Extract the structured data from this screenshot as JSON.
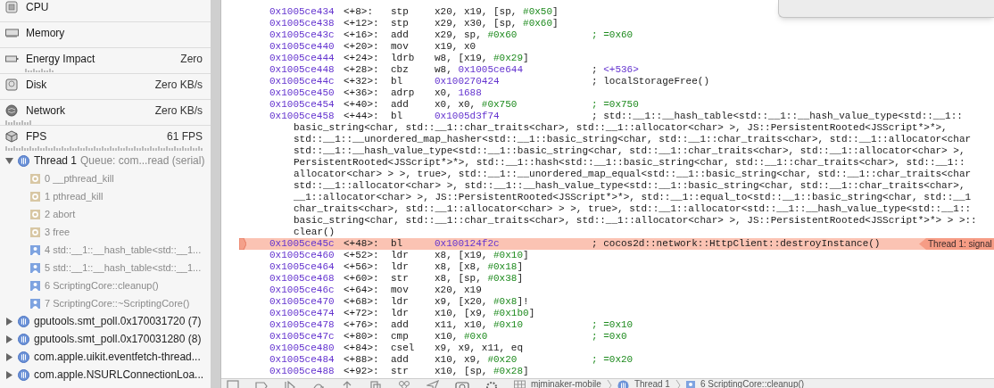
{
  "gauges": [
    {
      "kind": "cpu",
      "label": "CPU"
    },
    {
      "kind": "memory",
      "label": "Memory"
    },
    {
      "kind": "energy",
      "label": "Energy Impact",
      "value": "Zero"
    },
    {
      "kind": "disk",
      "label": "Disk",
      "value": "Zero KB/s"
    },
    {
      "kind": "network",
      "label": "Network",
      "value": "Zero KB/s"
    },
    {
      "kind": "fps",
      "label": "FPS",
      "value": "61 FPS"
    }
  ],
  "threads": [
    {
      "name": "Thread 1",
      "queue": "Queue: com...read (serial)",
      "expanded": true,
      "children": [
        {
          "kind": "system",
          "label": "0 __pthread_kill"
        },
        {
          "kind": "system",
          "label": "1 pthread_kill"
        },
        {
          "kind": "system",
          "label": "2 abort"
        },
        {
          "kind": "system",
          "label": "3 free"
        },
        {
          "kind": "user",
          "label": "4 std::__1::__hash_table<std::__1..."
        },
        {
          "kind": "user",
          "label": "5 std::__1::__hash_table<std::__1..."
        },
        {
          "kind": "user",
          "label": "6 ScriptingCore::cleanup()"
        },
        {
          "kind": "user",
          "label": "7 ScriptingCore::~ScriptingCore()"
        }
      ]
    },
    {
      "name": "gputools.smt_poll.0x170031720 (7)",
      "expanded": false
    },
    {
      "name": "gputools.smt_poll.0x170031280 (8)",
      "expanded": false
    },
    {
      "name": "com.apple.uikit.eventfetch-thread...",
      "expanded": false
    },
    {
      "name": "com.apple.NSURLConnectionLoa...",
      "expanded": false
    }
  ],
  "disassembly": [
    {
      "address": "0x1005ce434",
      "offset": "<+8>:",
      "mnemonic": "stp",
      "operands": "x20, x19, [sp, #0x50]",
      "current": false
    },
    {
      "address": "0x1005ce438",
      "offset": "<+12>:",
      "mnemonic": "stp",
      "operands": "x29, x30, [sp, #0x60]",
      "current": false
    },
    {
      "address": "0x1005ce43c",
      "offset": "<+16>:",
      "mnemonic": "add",
      "operands": "x29, sp, #0x60",
      "comment": "; =0x60",
      "current": false
    },
    {
      "address": "0x1005ce440",
      "offset": "<+20>:",
      "mnemonic": "mov",
      "operands": "x19, x0",
      "current": false
    },
    {
      "address": "0x1005ce444",
      "offset": "<+24>:",
      "mnemonic": "ldrb",
      "operands": "w8, [x19, #0x29]",
      "current": false
    },
    {
      "address": "0x1005ce448",
      "offset": "<+28>:",
      "mnemonic": "cbz",
      "operands": "w8, 0x1005ce644",
      "comment": "; <+536>",
      "current": false
    },
    {
      "address": "0x1005ce44c",
      "offset": "<+32>:",
      "mnemonic": "bl",
      "operands": "0x100270424",
      "comment": "; localStorageFree()",
      "current": false
    },
    {
      "address": "0x1005ce450",
      "offset": "<+36>:",
      "mnemonic": "adrp",
      "operands": "x0, 1688",
      "current": false
    },
    {
      "address": "0x1005ce454",
      "offset": "<+40>:",
      "mnemonic": "add",
      "operands": "x0, x0, #0x750",
      "comment": "; =0x750",
      "current": false
    },
    {
      "address": "0x1005ce458",
      "offset": "<+44>:",
      "mnemonic": "bl",
      "operands": "0x1005d3f74",
      "comment": "; std::__1::__hash_table<std::__1::__hash_value_type<std::__1::",
      "comment_continued": [
        "basic_string<char, std::__1::char_traits<char>, std::__1::allocator<char> >, JS::PersistentRooted<JSScript*>*>,",
        "std::__1::__unordered_map_hasher<std::__1::basic_string<char, std::__1::char_traits<char>, std::__1::allocator<char",
        "std::__1::__hash_value_type<std::__1::basic_string<char, std::__1::char_traits<char>, std::__1::allocator<char> >,",
        "PersistentRooted<JSScript*>*>, std::__1::hash<std::__1::basic_string<char, std::__1::char_traits<char>, std::__1::",
        "allocator<char> > >, true>, std::__1::__unordered_map_equal<std::__1::basic_string<char, std::__1::char_traits<char",
        "std::__1::allocator<char> >, std::__1::__hash_value_type<std::__1::basic_string<char, std::__1::char_traits<char>,",
        "__1::allocator<char> >, JS::PersistentRooted<JSScript*>*>, std::__1::equal_to<std::__1::basic_string<char, std::__1",
        "char_traits<char>, std::__1::allocator<char> > >, true>, std::__1::allocator<std::__1::__hash_value_type<std::__1::",
        "basic_string<char, std::__1::char_traits<char>, std::__1::allocator<char> >, JS::PersistentRooted<JSScript*>*> > >::",
        "clear()"
      ],
      "current": false
    },
    {
      "address": "0x1005ce45c",
      "offset": "<+48>:",
      "mnemonic": "bl",
      "operands": "0x100124f2c",
      "comment": "; cocos2d::network::HttpClient::destroyInstance()",
      "annotation": "Thread 1: signal",
      "current": true
    },
    {
      "address": "0x1005ce460",
      "offset": "<+52>:",
      "mnemonic": "ldr",
      "operands": "x8, [x19, #0x10]",
      "current": false
    },
    {
      "address": "0x1005ce464",
      "offset": "<+56>:",
      "mnemonic": "ldr",
      "operands": "x8, [x8, #0x18]",
      "current": false
    },
    {
      "address": "0x1005ce468",
      "offset": "<+60>:",
      "mnemonic": "str",
      "operands": "x8, [sp, #0x38]",
      "current": false
    },
    {
      "address": "0x1005ce46c",
      "offset": "<+64>:",
      "mnemonic": "mov",
      "operands": "x20, x19",
      "current": false
    },
    {
      "address": "0x1005ce470",
      "offset": "<+68>:",
      "mnemonic": "ldr",
      "operands": "x9, [x20, #0x8]!",
      "current": false
    },
    {
      "address": "0x1005ce474",
      "offset": "<+72>:",
      "mnemonic": "ldr",
      "operands": "x10, [x9, #0x1b0]",
      "current": false
    },
    {
      "address": "0x1005ce478",
      "offset": "<+76>:",
      "mnemonic": "add",
      "operands": "x11, x10, #0x10",
      "comment": "; =0x10",
      "current": false
    },
    {
      "address": "0x1005ce47c",
      "offset": "<+80>:",
      "mnemonic": "cmp",
      "operands": "x10, #0x0",
      "comment": "; =0x0",
      "current": false
    },
    {
      "address": "0x1005ce480",
      "offset": "<+84>:",
      "mnemonic": "csel",
      "operands": "x9, x9, x11, eq",
      "current": false
    },
    {
      "address": "0x1005ce484",
      "offset": "<+88>:",
      "mnemonic": "add",
      "operands": "x10, x9, #0x20",
      "comment": "; =0x20",
      "current": false
    },
    {
      "address": "0x1005ce488",
      "offset": "<+92>:",
      "mnemonic": "str",
      "operands": "x10, [sp, #0x28]",
      "current": false
    }
  ],
  "breadcrumb": [
    "mjminaker-mobile",
    "Thread 1",
    "6 ScriptingCore::cleanup()"
  ]
}
